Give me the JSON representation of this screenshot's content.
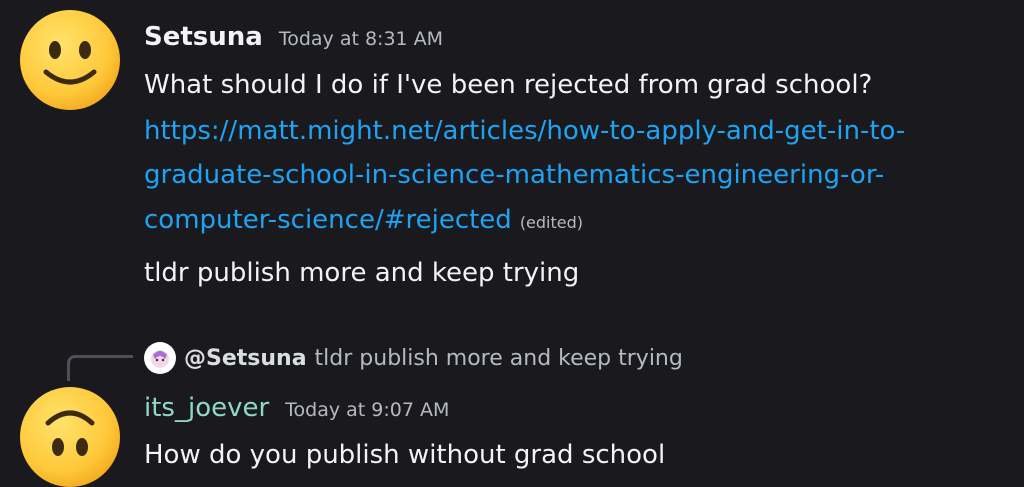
{
  "messages": [
    {
      "author": "Setsuna",
      "timestamp": "Today at 8:31 AM",
      "avatar_icon": "smiling-face-emoji",
      "text": "What should I do if I've been rejected from grad school?",
      "link_lines": [
        "https://matt.might.net/articles/how-to-apply-and-get-in-to-",
        "graduate-school-in-science-mathematics-engineering-or-",
        "computer-science/#rejected"
      ],
      "edited_label": "(edited)",
      "followup": "tldr publish more and keep trying"
    },
    {
      "author": "its_joever",
      "author_color": "#8fd8c7",
      "timestamp": "Today at 9:07 AM",
      "avatar_icon": "upside-down-face-emoji",
      "reply_to": {
        "mention": "@Setsuna",
        "preview": "tldr publish more and keep trying"
      },
      "text": "How do you publish without grad school"
    }
  ],
  "colors": {
    "background": "#1a1a1e",
    "link": "#1ea3f3",
    "muted": "#b5bac1"
  }
}
